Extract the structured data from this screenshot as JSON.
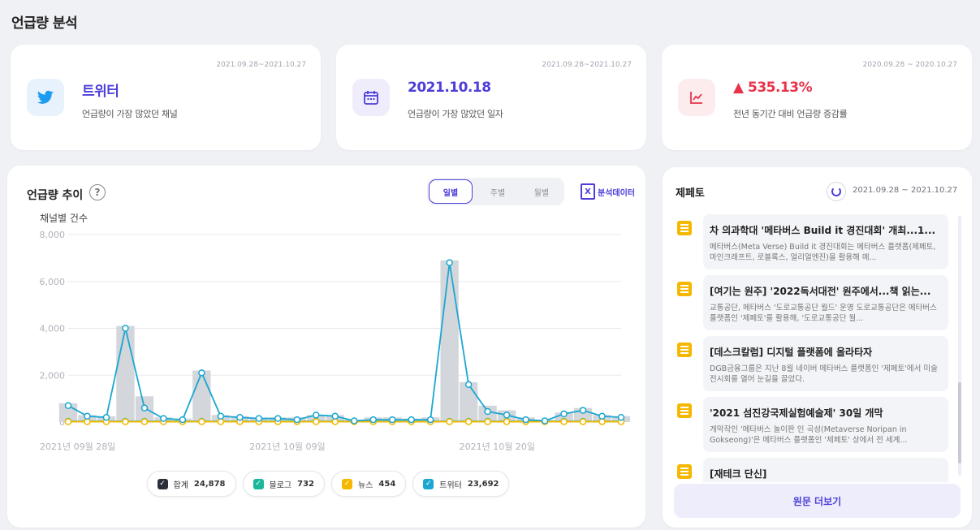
{
  "page": {
    "title": "언급량 분석"
  },
  "stats": [
    {
      "date": "2021.09.28~2021.10.27",
      "value": "트위터",
      "desc": "언급량이 가장 많았던 채널",
      "icon": "twitter-icon",
      "color": "#4c3ed9",
      "icon_bg": "#e8f2fc",
      "icon_color": "#1d9bf0"
    },
    {
      "date": "2021.09.28~2021.10.27",
      "value": "2021.10.18",
      "desc": "언급량이 가장 많았던 일자",
      "icon": "calendar-icon",
      "color": "#4c3ed9",
      "icon_bg": "#efedfb",
      "icon_color": "#4c3ed9"
    },
    {
      "date": "2020.09.28 ~ 2020.10.27",
      "value": "▲ 535.13%",
      "desc": "전년 동기간 대비 언급량 증감률",
      "icon": "trend-chart-icon",
      "color": "#e8334a",
      "icon_bg": "#fdeced",
      "icon_color": "#e8334a"
    }
  ],
  "trend": {
    "title": "언급량 추이",
    "help": "?",
    "tabs": [
      "일별",
      "주별",
      "월별"
    ],
    "active_tab": "일별",
    "export_label": "분석데이터",
    "export_icon": "X",
    "y_title": "채널별 건수"
  },
  "chart_data": {
    "type": "line",
    "x": [
      "2021-09-28",
      "2021-09-29",
      "2021-09-30",
      "2021-10-01",
      "2021-10-02",
      "2021-10-03",
      "2021-10-04",
      "2021-10-05",
      "2021-10-06",
      "2021-10-07",
      "2021-10-08",
      "2021-10-09",
      "2021-10-10",
      "2021-10-11",
      "2021-10-12",
      "2021-10-13",
      "2021-10-14",
      "2021-10-15",
      "2021-10-16",
      "2021-10-17",
      "2021-10-18",
      "2021-10-19",
      "2021-10-20",
      "2021-10-21",
      "2021-10-22",
      "2021-10-23",
      "2021-10-24",
      "2021-10-25",
      "2021-10-26",
      "2021-10-27"
    ],
    "x_tick_labels": [
      "2021년 09월 28일",
      "2021년 10월 09일",
      "2021년 10월 20일"
    ],
    "x_tick_index": [
      0,
      11,
      22
    ],
    "y_ticks": [
      "8,000",
      "6,000",
      "4,000",
      "2,000",
      "0"
    ],
    "ylim": [
      0,
      8000
    ],
    "series": [
      {
        "name": "합계",
        "display": "bar",
        "color": "#d3d6db",
        "values": [
          800,
          300,
          250,
          4100,
          1100,
          200,
          150,
          2200,
          300,
          250,
          200,
          200,
          200,
          300,
          300,
          100,
          200,
          200,
          150,
          200,
          6900,
          1700,
          700,
          500,
          200,
          100,
          400,
          600,
          300,
          250
        ]
      },
      {
        "name": "블로그",
        "display": "line",
        "color": "#19b89a",
        "values": [
          30,
          30,
          30,
          30,
          30,
          30,
          30,
          30,
          30,
          30,
          30,
          30,
          30,
          30,
          30,
          30,
          30,
          30,
          30,
          30,
          30,
          30,
          30,
          30,
          30,
          30,
          30,
          30,
          30,
          30
        ]
      },
      {
        "name": "뉴스",
        "display": "line",
        "color": "#f5b800",
        "values": [
          15,
          15,
          15,
          15,
          15,
          15,
          15,
          15,
          15,
          15,
          15,
          15,
          15,
          15,
          15,
          15,
          15,
          15,
          15,
          15,
          15,
          15,
          15,
          15,
          15,
          15,
          15,
          15,
          15,
          15
        ]
      },
      {
        "name": "트위터",
        "display": "line",
        "color": "#1ba7d1",
        "values": [
          700,
          250,
          200,
          4000,
          600,
          150,
          100,
          2100,
          250,
          200,
          150,
          150,
          100,
          300,
          250,
          50,
          100,
          100,
          100,
          100,
          6800,
          1600,
          450,
          300,
          100,
          50,
          350,
          500,
          250,
          200
        ]
      }
    ]
  },
  "legend": [
    {
      "label": "합계",
      "value": "24,878",
      "color": "#2a2f3a",
      "check": "✓"
    },
    {
      "label": "블로그",
      "value": "732",
      "color": "#19b89a",
      "check": "✓"
    },
    {
      "label": "뉴스",
      "value": "454",
      "color": "#f5b800",
      "check": "✓"
    },
    {
      "label": "트위터",
      "value": "23,692",
      "color": "#1ba7d1",
      "check": "✓"
    }
  ],
  "news": {
    "title": "제페토",
    "date": "2021.09.28 ~ 2021.10.27",
    "items": [
      {
        "headline": "차 의과학대 '메타버스 Build it 경진대회' 개최...1...",
        "snippet": "메타버스(Meta Verse) Build it 경진대회는 메타버스 플랫폼(제페토, 마인크래프트, 로블록스, 얼리얼엔진)을 활용해 메..."
      },
      {
        "headline": "[여기는 원주] '2022독서대전' 원주에서...책 읽는...",
        "snippet": "교통공단, 메타버스 '도로교통공단 월드' 운영 도로교통공단은 메타버스 플랫폼인 '제페토'를 활용해, '도로교통공단 월..."
      },
      {
        "headline": "[데스크칼럼] 디지털 플랫폼에 올라타자",
        "snippet": "DGB금융그룹은 지난 8월 네이버 메타버스 플랫폼인 '제페토'에서 미술전시회를 열어 눈길을 끌었다."
      },
      {
        "headline": "'2021 섬진강국제실험예술제' 30일 개막",
        "snippet": "개막작인 '메타버스 놀이판 인 곡성(Metaverse Noripan in Gokseong)'은 메타버스 플랫폼인 '제페토' 상에서 전 세계..."
      },
      {
        "headline": "[재테크 단신]",
        "snippet": ""
      }
    ],
    "more_label": "원문 더보기"
  }
}
